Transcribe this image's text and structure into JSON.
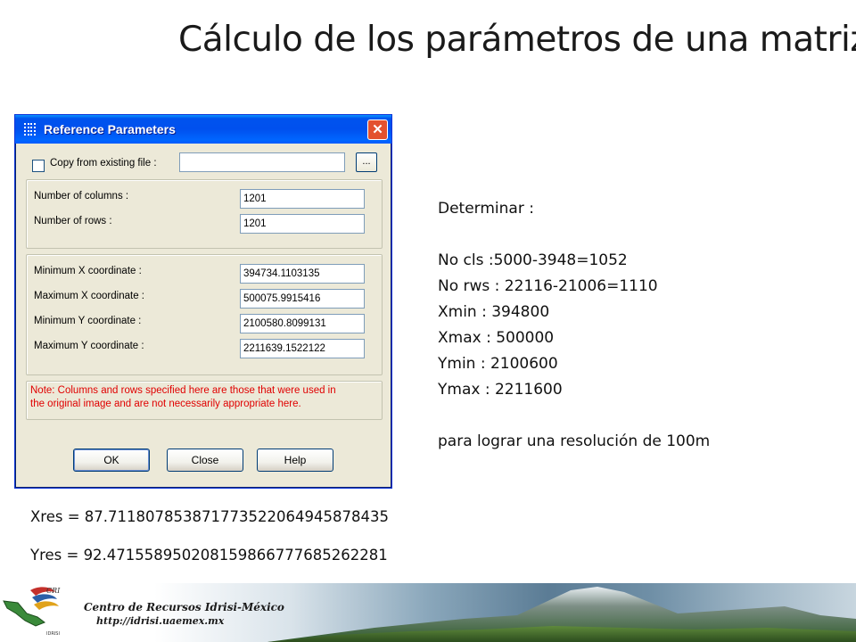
{
  "slide": {
    "title": "Cálculo de los parámetros de una matriz"
  },
  "dialog": {
    "title": "Reference Parameters",
    "copy_label": "Copy from existing file :",
    "copy_value": "",
    "ellipsis_label": "...",
    "columns_label": "Number of columns :",
    "columns_value": "1201",
    "rows_label": "Number of rows :",
    "rows_value": "1201",
    "min_x_label": "Minimum X coordinate :",
    "min_x_value": "394734.1103135",
    "max_x_label": "Maximum X coordinate :",
    "max_x_value": "500075.9915416",
    "min_y_label": "Minimum Y coordinate :",
    "min_y_value": "2100580.8099131",
    "max_y_label": "Maximum Y coordinate :",
    "max_y_value": "2211639.1522122",
    "note_line1": "Note: Columns and rows specified here are those that were used in",
    "note_line2": "the original image and are not necessarily appropriate here.",
    "ok_label": "OK",
    "close_label": "Close",
    "help_label": "Help",
    "note_color": "#e00000",
    "titlebar_color": "#0054e3"
  },
  "notes": {
    "heading": "Determinar :",
    "cols": "No cls :5000-3948=1052",
    "rows": "No rws : 22116-21006=1110",
    "xmin": "Xmin : 394800",
    "xmax": "Xmax : 500000",
    "ymin": "Ymin : 2100600",
    "ymax": "Ymax : 2211600",
    "goal": "para lograr una resolución de 100m"
  },
  "results": {
    "xres": "Xres = 87.711807853871773522064945878435",
    "yres": "Yres = 92.471558950208159866777685262281"
  },
  "footer": {
    "logo_text": "CRI",
    "logo_sub": "IDRISI",
    "title": "Centro de Recursos Idrisi-México",
    "url": "http://idrisi.uaemex.mx"
  }
}
